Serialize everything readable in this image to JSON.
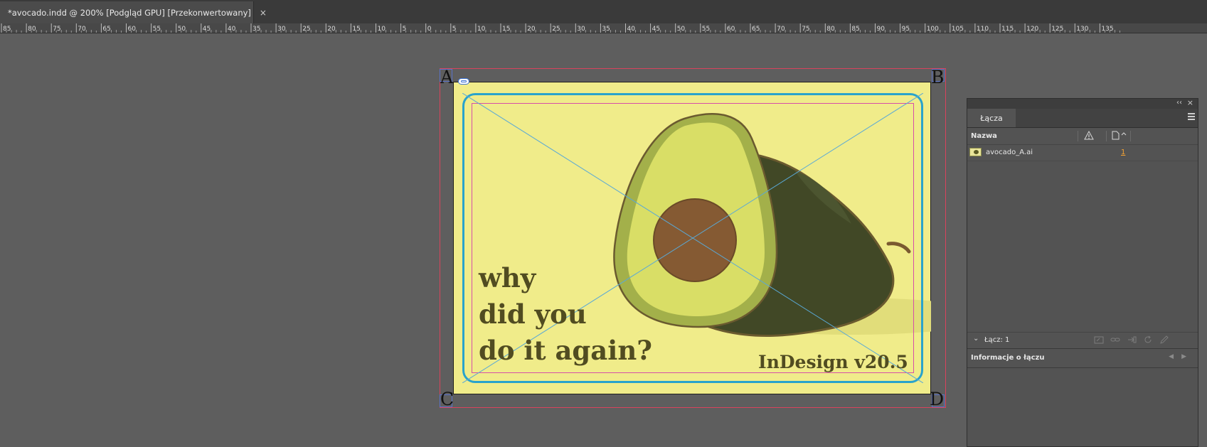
{
  "document_tab": {
    "title": "*avocado.indd @ 200% [Podgląd GPU] [Przekonwertowany]",
    "close_glyph": "×"
  },
  "ruler": {
    "ticks": [
      "85",
      "80",
      "75",
      "70",
      "65",
      "60",
      "55",
      "50",
      "45",
      "40",
      "35",
      "30",
      "25",
      "20",
      "15",
      "10",
      "5",
      "0",
      "5",
      "10",
      "15",
      "20",
      "25",
      "30",
      "35",
      "40",
      "45",
      "50",
      "55",
      "60",
      "65",
      "70",
      "75",
      "80",
      "85",
      "90",
      "95",
      "100",
      "105",
      "110",
      "115",
      "120",
      "125",
      "130",
      "135"
    ]
  },
  "artboard": {
    "background": "#f0ec8a",
    "frame_color": "#29a3cc",
    "corners": {
      "top_left": "A",
      "top_right": "B",
      "bottom_left": "C",
      "bottom_right": "D"
    },
    "headline": [
      "why",
      "did you",
      "do it again?"
    ],
    "version_text": "InDesign v20.5",
    "text_color": "#514c21"
  },
  "links_panel": {
    "tab_label": "Łącza",
    "collapse_glyph": "‹‹",
    "close_glyph": "×",
    "column_name": "Nazwa",
    "links": [
      {
        "name": "avocado_A.ai",
        "page": "1"
      }
    ],
    "status_label": "Łącz: 1",
    "info_label": "Informacje o łączu",
    "prev_glyph": "◀",
    "next_glyph": "▶",
    "chevron_glyph": "⌄"
  }
}
